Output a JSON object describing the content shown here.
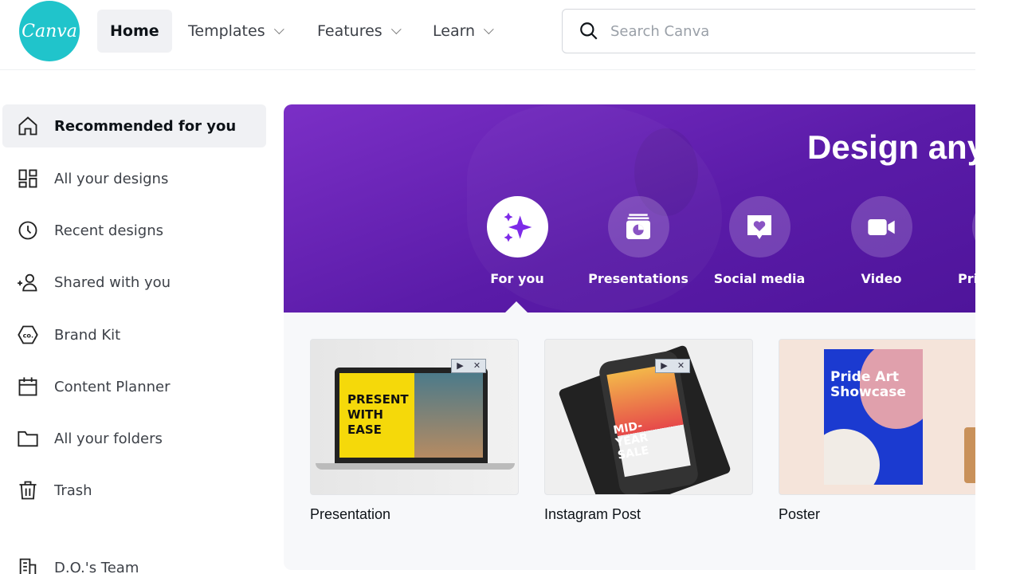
{
  "header": {
    "logo_text": "Canva",
    "nav": [
      {
        "label": "Home",
        "active": true
      },
      {
        "label": "Templates"
      },
      {
        "label": "Features"
      },
      {
        "label": "Learn"
      }
    ],
    "search_placeholder": "Search Canva"
  },
  "sidebar": {
    "items": [
      {
        "label": "Recommended for you",
        "icon": "home-icon",
        "active": true
      },
      {
        "label": "All your designs",
        "icon": "grid-icon"
      },
      {
        "label": "Recent designs",
        "icon": "clock-icon"
      },
      {
        "label": "Shared with you",
        "icon": "shared-users-icon"
      },
      {
        "label": "Brand Kit",
        "icon": "brand-kit-icon"
      },
      {
        "label": "Content Planner",
        "icon": "calendar-icon"
      },
      {
        "label": "All your folders",
        "icon": "folder-icon"
      },
      {
        "label": "Trash",
        "icon": "trash-icon"
      }
    ],
    "team": {
      "label": "D.O.'s Team",
      "icon": "building-icon"
    }
  },
  "banner": {
    "title": "Design any",
    "categories": [
      {
        "label": "For you",
        "icon": "sparkle-icon",
        "active": true
      },
      {
        "label": "Presentations",
        "icon": "presentation-icon"
      },
      {
        "label": "Social media",
        "icon": "heart-bubble-icon"
      },
      {
        "label": "Video",
        "icon": "video-camera-icon"
      },
      {
        "label": "Pri"
      }
    ]
  },
  "cards": [
    {
      "label": "Presentation",
      "thumb_text": "PRESENT WITH EASE"
    },
    {
      "label": "Instagram Post",
      "thumb_text": "MID-YEAR SALE"
    },
    {
      "label": "Poster",
      "thumb_text": "Pride Art Showcase"
    }
  ],
  "colors": {
    "brand": "#20c4cb",
    "banner": "#5a1ba8",
    "accent": "#7d2ae8"
  }
}
